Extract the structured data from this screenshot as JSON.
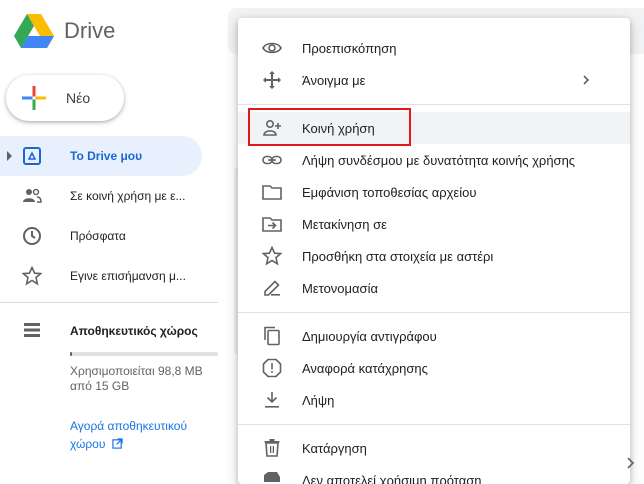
{
  "app": {
    "name": "Drive"
  },
  "new_button": {
    "label": "Νέο"
  },
  "nav": {
    "items": [
      {
        "label": "Το Drive μου",
        "icon": "my-drive-icon",
        "active": true
      },
      {
        "label": "Σε κοινή χρήση με ε...",
        "icon": "shared-people-icon",
        "active": false
      },
      {
        "label": "Πρόσφατα",
        "icon": "clock-icon",
        "active": false
      },
      {
        "label": "Εγινε επισήμανση μ...",
        "icon": "star-icon",
        "active": false
      }
    ]
  },
  "storage": {
    "title": "Αποθηκευτικός χώρος",
    "used_text": "Χρησιμοποιείται 98,8 MB από 15 GB",
    "used_fraction": 0.0066,
    "buy_label": "Αγορά αποθηκευτικού χώρου"
  },
  "context_menu": {
    "items": [
      {
        "label": "Προεπισκόπηση",
        "icon": "eye-icon"
      },
      {
        "label": "Άνοιγμα με",
        "icon": "open-with-icon",
        "submenu": true
      },
      {
        "label": "Κοινή χρήση",
        "icon": "person-add-icon",
        "highlighted": true
      },
      {
        "label": "Λήψη συνδέσμου με δυνατότητα κοινής χρήσης",
        "icon": "link-icon"
      },
      {
        "label": "Εμφάνιση τοποθεσίας αρχείου",
        "icon": "folder-icon"
      },
      {
        "label": "Μετακίνηση σε",
        "icon": "move-to-folder-icon"
      },
      {
        "label": "Προσθήκη στα στοιχεία με αστέρι",
        "icon": "star-icon"
      },
      {
        "label": "Μετονομασία",
        "icon": "pencil-icon"
      },
      {
        "label": "Δημιουργία αντιγράφου",
        "icon": "copy-icon"
      },
      {
        "label": "Αναφορά κατάχρησης",
        "icon": "report-icon"
      },
      {
        "label": "Λήψη",
        "icon": "download-icon"
      },
      {
        "label": "Κατάργηση",
        "icon": "trash-icon"
      },
      {
        "label": "Δεν αποτελεί χρήσιμη πρόταση",
        "icon": "not-helpful-icon"
      }
    ]
  },
  "colors": {
    "accent": "#1a73e8",
    "active_bg": "#e8f0fe",
    "highlight_box": "#e0191a"
  }
}
